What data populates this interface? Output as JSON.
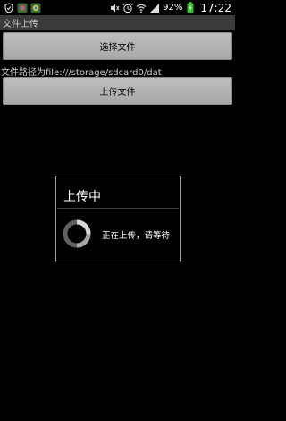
{
  "statusbar": {
    "battery_percent": "92%",
    "time": "17:22",
    "icons": [
      "shield-check-icon",
      "app-notification-icon",
      "app-notification-icon",
      "mute-icon",
      "alarm-icon",
      "wifi-icon",
      "signal-icon",
      "battery-charging-icon"
    ]
  },
  "app": {
    "title": "文件上传"
  },
  "buttons": {
    "select_file": "选择文件",
    "upload_file": "上传文件"
  },
  "path_label": "文件路径为file:///storage/sdcard0/dat",
  "dialog": {
    "title": "上传中",
    "message": "正在上传，请等待"
  },
  "colors": {
    "battery": "#39c12b",
    "background": "#000000",
    "button": "#b4b4b4"
  }
}
